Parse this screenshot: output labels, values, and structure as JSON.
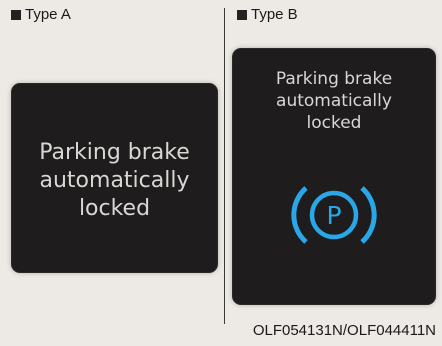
{
  "panels": {
    "type_a": {
      "label": "Type A",
      "message": [
        "Parking brake",
        "automatically",
        "locked"
      ]
    },
    "type_b": {
      "label": "Type B",
      "message": [
        "Parking brake",
        "automatically",
        "locked"
      ],
      "icon": "parking-brake-icon",
      "icon_letter": "P",
      "icon_color": "#29a7e8"
    }
  },
  "caption": "OLF054131N/OLF044411N",
  "colors": {
    "background": "#ede9e5",
    "screen": "#1e1c1c",
    "screen_text": "#d9d7d4",
    "accent_blue": "#29a7e8"
  }
}
